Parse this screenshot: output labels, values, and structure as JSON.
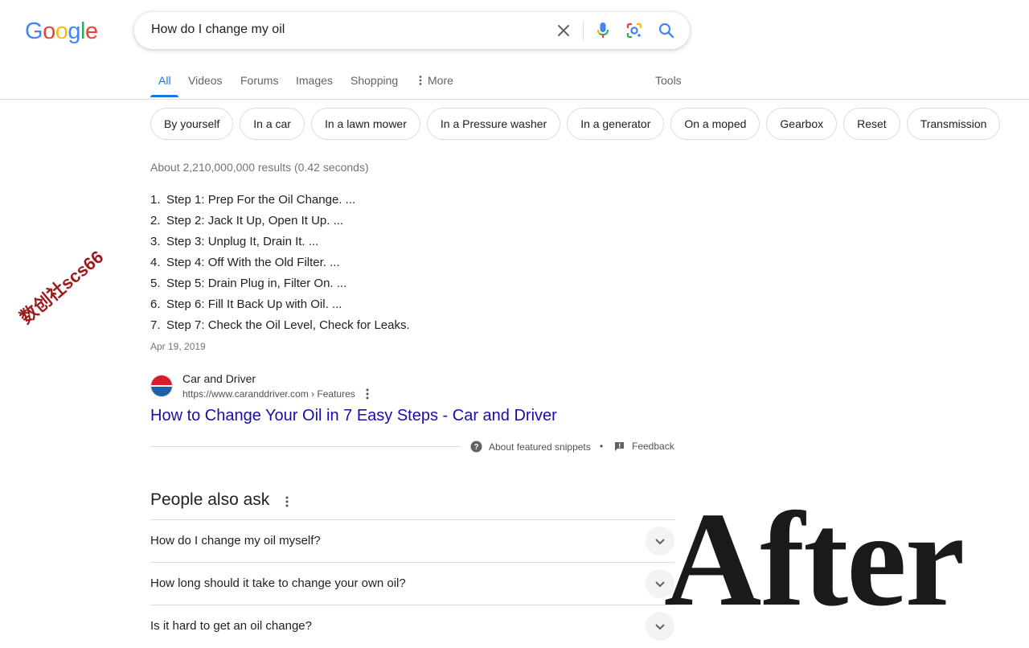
{
  "logo": {
    "letters": [
      "G",
      "o",
      "o",
      "g",
      "l",
      "e"
    ],
    "colors": [
      "#4285F4",
      "#EA4335",
      "#FBBC05",
      "#4285F4",
      "#34A853",
      "#EA4335"
    ]
  },
  "search": {
    "query": "How do I change my oil",
    "icons": [
      "close-icon",
      "microphone-icon",
      "lens-icon",
      "search-icon"
    ]
  },
  "tabs": [
    {
      "label": "All",
      "active": true
    },
    {
      "label": "Videos"
    },
    {
      "label": "Forums"
    },
    {
      "label": "Images"
    },
    {
      "label": "Shopping"
    },
    {
      "label": "More"
    }
  ],
  "tools_label": "Tools",
  "chips": [
    "By yourself",
    "In a car",
    "In a lawn mower",
    "In a Pressure washer",
    "In a generator",
    "On a moped",
    "Gearbox",
    "Reset",
    "Transmission"
  ],
  "stats": "About 2,210,000,000 results (0.42 seconds)",
  "featured": {
    "steps": [
      {
        "num": "1.",
        "text": "Step 1: Prep For the Oil Change. ..."
      },
      {
        "num": "2.",
        "text": "Step 2: Jack It Up, Open It Up. ..."
      },
      {
        "num": "3.",
        "text": "Step 3: Unplug It, Drain It. ..."
      },
      {
        "num": "4.",
        "text": "Step 4: Off With the Old Filter. ..."
      },
      {
        "num": "5.",
        "text": "Step 5: Drain Plug in, Filter On. ..."
      },
      {
        "num": "6.",
        "text": "Step 6: Fill It Back Up with Oil. ..."
      },
      {
        "num": "7.",
        "text": "Step 7: Check the Oil Level, Check for Leaks."
      }
    ],
    "date": "Apr 19, 2019",
    "source_name": "Car and Driver",
    "source_url": "https://www.caranddriver.com › Features",
    "link_title": "How to Change Your Oil in 7 Easy Steps - Car and Driver",
    "about_label": "About featured snippets",
    "separator": "•",
    "feedback_label": "Feedback"
  },
  "paa": {
    "title": "People also ask",
    "questions": [
      "How do I change my oil myself?",
      "How long should it take to change your own oil?",
      "Is it hard to get an oil change?"
    ]
  },
  "watermark": "数创社scs66",
  "overlay_text": "After",
  "colors": {
    "accent": "#1a73e8",
    "link": "#1a0dab",
    "muted": "#70757a"
  }
}
